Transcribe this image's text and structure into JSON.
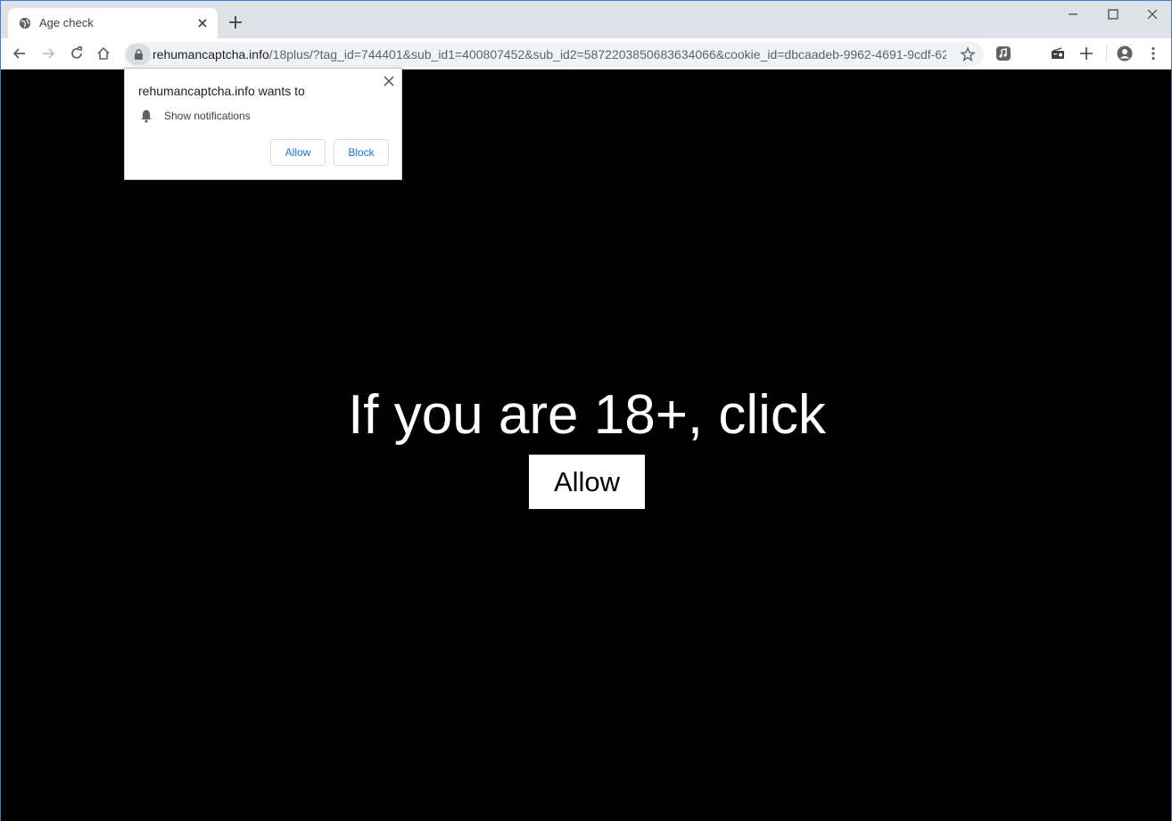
{
  "browser": {
    "tab_title": "Age check",
    "url_host": "rehumancaptcha.info",
    "url_path": "/18plus/?tag_id=744401&sub_id1=400807452&sub_id2=5872203850683634066&cookie_id=dbcaadeb-9962-4691-9cdf-627..."
  },
  "popup": {
    "title": "rehumancaptcha.info wants to",
    "permission": "Show notifications",
    "allow_label": "Allow",
    "block_label": "Block"
  },
  "page": {
    "headline": "If you are 18+, click",
    "button_label": "Allow"
  },
  "icons": {
    "favicon": "globe-icon",
    "bell": "bell-icon"
  },
  "colors": {
    "page_background": "#000000",
    "accent": "#1a73e8"
  }
}
